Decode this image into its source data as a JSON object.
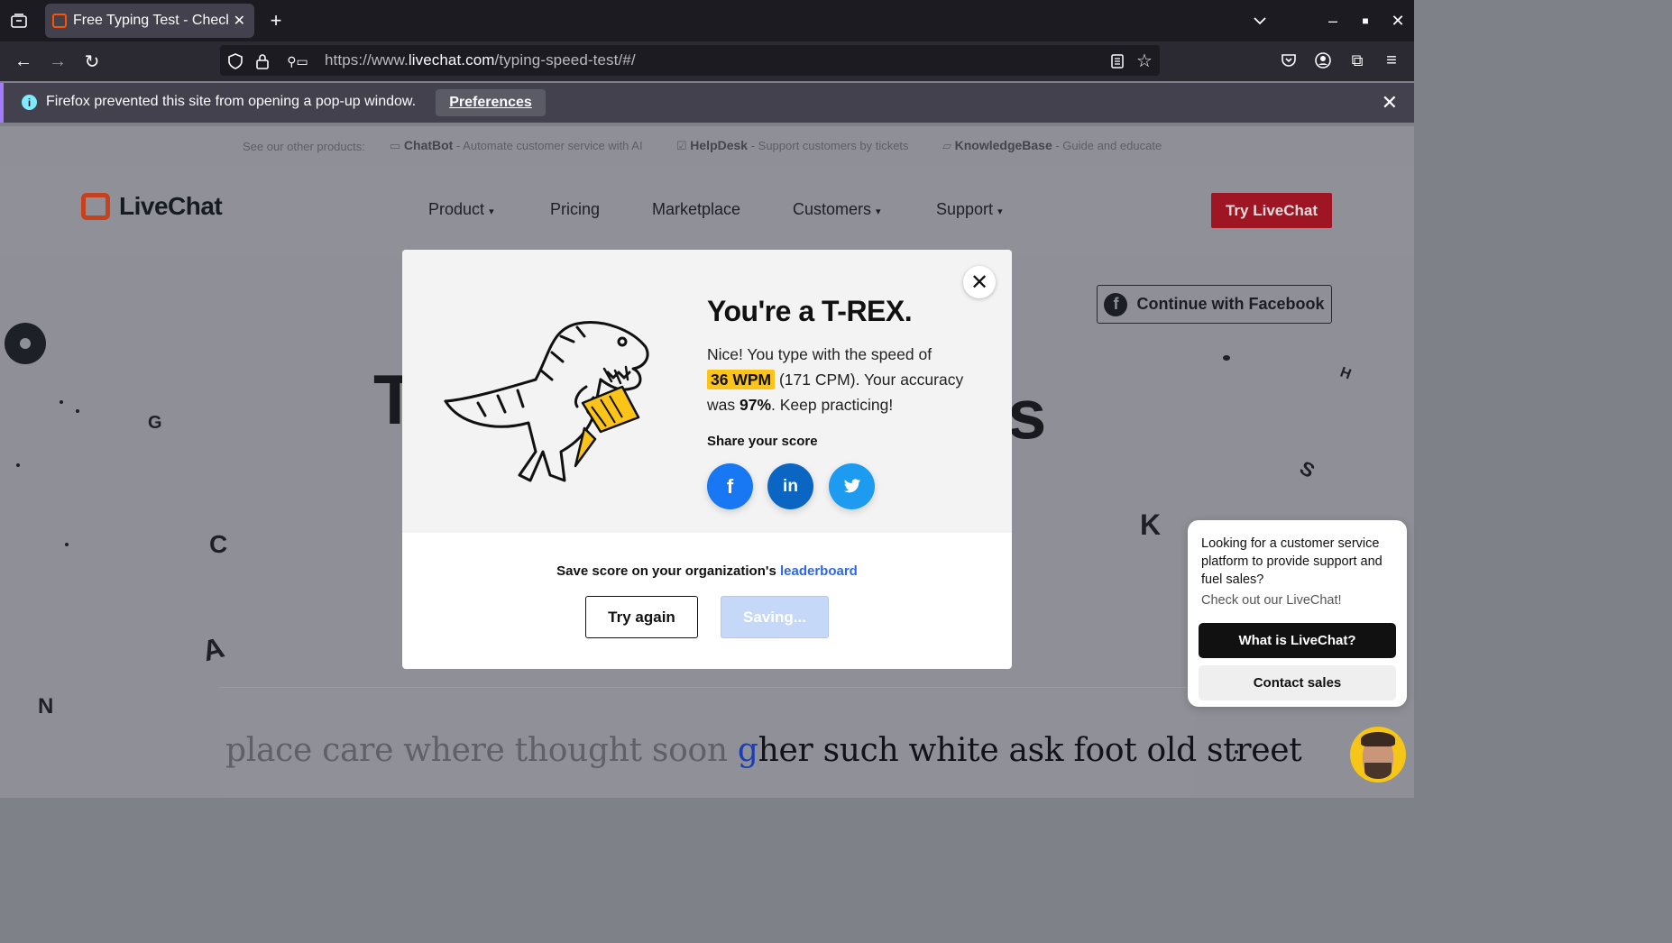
{
  "browser": {
    "tab_title": "Free Typing Test - Check",
    "url_prefix": "https://www.",
    "url_domain": "livechat.com",
    "url_path": "/typing-speed-test/#/",
    "notification": {
      "message": "Firefox prevented this site from opening a pop-up window.",
      "button": "Preferences"
    }
  },
  "products_strip": {
    "lead": "See our other products:",
    "items": [
      {
        "name": "ChatBot",
        "desc": " - Automate customer service with AI"
      },
      {
        "name": "HelpDesk",
        "desc": " - Support customers by tickets"
      },
      {
        "name": "KnowledgeBase",
        "desc": " - Guide and educate"
      }
    ]
  },
  "header": {
    "logo": "LiveChat",
    "nav": [
      "Product",
      "Pricing",
      "Marketplace",
      "Customers",
      "Support"
    ],
    "nav_caret": "▾",
    "cta": "Try LiveChat"
  },
  "facebook_button": "Continue with Facebook",
  "headline_fragments": {
    "left": "T",
    "right": "s"
  },
  "decor_letters": [
    "G",
    "C",
    "A",
    "N",
    "K",
    "S",
    "H"
  ],
  "typing": {
    "done": "place care where thought soon ",
    "current": "g",
    "todo": "her such white ask foot old street"
  },
  "modal": {
    "title": "You're a T-REX.",
    "line1": "Nice! You type with the speed of",
    "wpm": "36 WPM",
    "cpm": " (171 CPM). Your accuracy was ",
    "accuracy": "97%",
    "after": ". Keep practicing!",
    "share_label": "Share your score",
    "share_icons": [
      "facebook-icon",
      "linkedin-icon",
      "twitter-icon"
    ],
    "leaderboard_text": "Save score on your organization's ",
    "leaderboard_link": "leaderboard",
    "try_again": "Try again",
    "saving": "Saving..."
  },
  "chat_widget": {
    "question": "Looking for a customer service platform to provide support and fuel sales?",
    "cta_text": "Check out our LiveChat!",
    "primary": "What is LiveChat?",
    "secondary": "Contact sales"
  },
  "colors": {
    "accent_red": "#a01523",
    "wpm_highlight": "#fcc419",
    "facebook_blue": "#1877f2",
    "linkedin_blue": "#0a66c2",
    "twitter_blue": "#1d9bf0",
    "link_blue": "#2c67e8"
  }
}
